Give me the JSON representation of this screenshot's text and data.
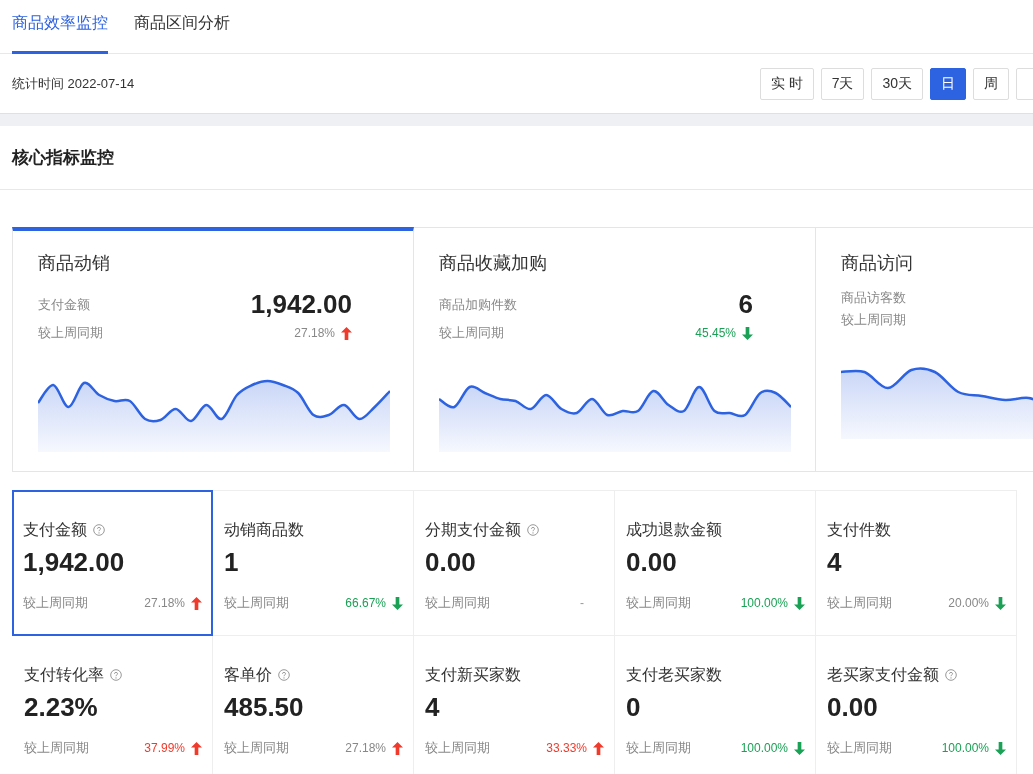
{
  "tabs": [
    {
      "label": "商品效率监控",
      "selected": true
    },
    {
      "label": "商品区间分析",
      "selected": false
    }
  ],
  "stats_time": "统计时间 2022-07-14",
  "periods": [
    {
      "label": "实 时",
      "selected": false
    },
    {
      "label": "7天",
      "selected": false
    },
    {
      "label": "30天",
      "selected": false
    },
    {
      "label": "日",
      "selected": true
    },
    {
      "label": "周",
      "selected": false
    }
  ],
  "section_title": "核心指标监控",
  "overview_cards": [
    {
      "title": "商品动销",
      "metric": "支付金额",
      "value": "1,942.00",
      "compare_label": "较上周同期",
      "change": "27.18%",
      "rising": true,
      "color": "#888888",
      "selected": true
    },
    {
      "title": "商品收藏加购",
      "metric": "商品加购件数",
      "value": "6",
      "compare_label": "较上周同期",
      "change": "45.45%",
      "rising": false,
      "color": "#1aa155",
      "selected": false
    },
    {
      "title": "商品访问",
      "metric": "商品访客数",
      "compare_label": "较上周同期",
      "selected": false
    }
  ],
  "metrics": [
    {
      "label": "支付金额",
      "help": true,
      "value": "1,942.00",
      "compare_label": "较上周同期",
      "change": "27.18%",
      "rising": true,
      "color": "#888888",
      "selected": true
    },
    {
      "label": "动销商品数",
      "help": false,
      "value": "1",
      "compare_label": "较上周同期",
      "change": "66.67%",
      "rising": false,
      "color": "#1aa155",
      "selected": false
    },
    {
      "label": "分期支付金额",
      "help": true,
      "value": "0.00",
      "compare_label": "较上周同期",
      "change": "-",
      "selected": false
    },
    {
      "label": "成功退款金额",
      "help": false,
      "value": "0.00",
      "compare_label": "较上周同期",
      "change": "100.00%",
      "rising": false,
      "color": "#1aa155",
      "selected": false
    },
    {
      "label": "支付件数",
      "help": false,
      "value": "4",
      "compare_label": "较上周同期",
      "change": "20.00%",
      "rising": false,
      "color": "#888888",
      "selected": false
    },
    {
      "label": "支付转化率",
      "help": true,
      "value": "2.23%",
      "compare_label": "较上周同期",
      "change": "37.99%",
      "rising": true,
      "color": "#f03b2c",
      "selected": false
    },
    {
      "label": "客单价",
      "help": true,
      "value": "485.50",
      "compare_label": "较上周同期",
      "change": "27.18%",
      "rising": true,
      "color": "#888888",
      "selected": false
    },
    {
      "label": "支付新买家数",
      "help": false,
      "value": "4",
      "compare_label": "较上周同期",
      "change": "33.33%",
      "rising": true,
      "color": "#f03b2c",
      "selected": false
    },
    {
      "label": "支付老买家数",
      "help": false,
      "value": "0",
      "compare_label": "较上周同期",
      "change": "100.00%",
      "rising": false,
      "color": "#1aa155",
      "selected": false
    },
    {
      "label": "老买家支付金额",
      "help": true,
      "value": "0.00",
      "compare_label": "较上周同期",
      "change": "100.00%",
      "rising": false,
      "color": "#1aa155",
      "selected": false
    }
  ]
}
